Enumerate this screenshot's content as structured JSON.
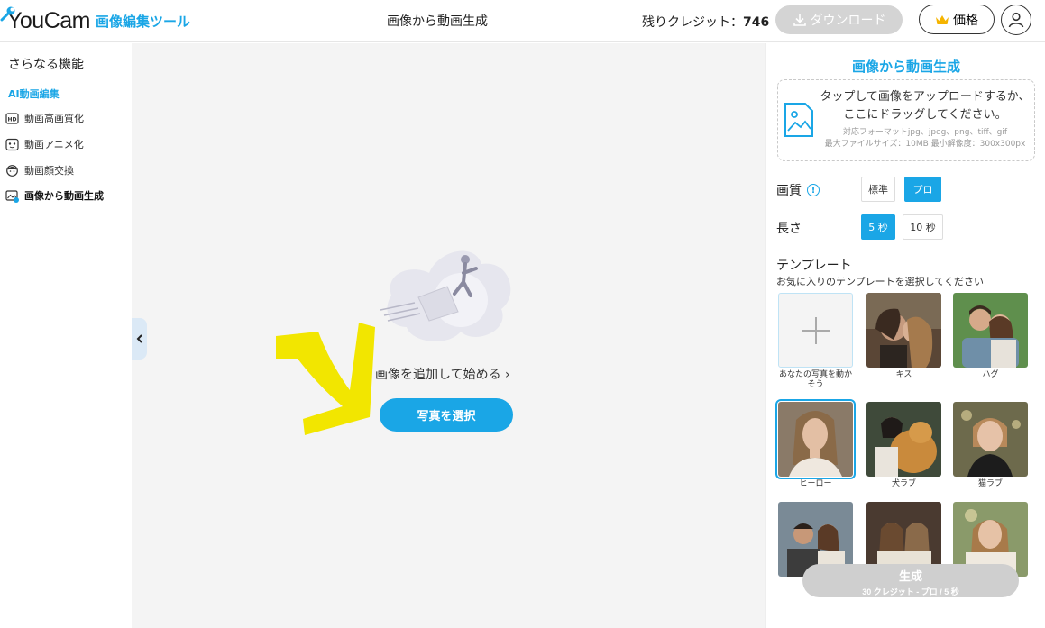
{
  "header": {
    "logo_text": "YouCam",
    "logo_sub": "画像編集ツール",
    "title": "画像から動画生成",
    "credits_label": "残りクレジット：",
    "credits_value": "746",
    "download_label": "ダウンロード",
    "price_label": "価格",
    "icons": {
      "logo": "wrench-icon",
      "download": "download-icon",
      "price": "crown-icon",
      "account": "user-icon"
    }
  },
  "sidebar": {
    "heading": "さらなる機能",
    "section": "AI動画編集",
    "items": [
      {
        "label": "動画高画質化",
        "icon": "hd-icon"
      },
      {
        "label": "動画アニメ化",
        "icon": "anime-face-icon"
      },
      {
        "label": "動画顔交換",
        "icon": "face-swap-icon"
      },
      {
        "label": "画像から動画生成",
        "icon": "image-to-video-icon",
        "active": true
      }
    ]
  },
  "canvas": {
    "start_text": "画像を追加して始める",
    "select_button": "写真を選択"
  },
  "panel": {
    "title": "画像から動画生成",
    "upload": {
      "line1": "タップして画像をアップロードするか、",
      "line2": "ここにドラッグしてください。",
      "formats": "対応フォーマットjpg、jpeg、png、tiff、gif",
      "limits": "最大ファイルサイズ：10MB 最小解像度：300x300px"
    },
    "quality": {
      "label": "画質",
      "options": [
        "標準",
        "プロ"
      ],
      "selected": "プロ"
    },
    "length": {
      "label": "長さ",
      "options": [
        "5 秒",
        "10 秒"
      ],
      "selected": "5 秒"
    },
    "templates": {
      "title": "テンプレート",
      "subtitle": "お気に入りのテンプレートを選択してください",
      "items": [
        {
          "label": "あなたの写真を動かそう"
        },
        {
          "label": "キス"
        },
        {
          "label": "ハグ"
        },
        {
          "label": "ヒーロー"
        },
        {
          "label": "犬ラブ"
        },
        {
          "label": "猫ラブ"
        },
        {
          "label": ""
        },
        {
          "label": ""
        },
        {
          "label": ""
        }
      ]
    },
    "generate": {
      "label": "生成",
      "sub": "30 クレジット - プロ / 5 秒"
    }
  },
  "colors": {
    "accent": "#1aa6e6",
    "disabled": "#d4d4d4",
    "canvas_bg": "#f4f4f4",
    "annotation_yellow": "#f2e600"
  }
}
